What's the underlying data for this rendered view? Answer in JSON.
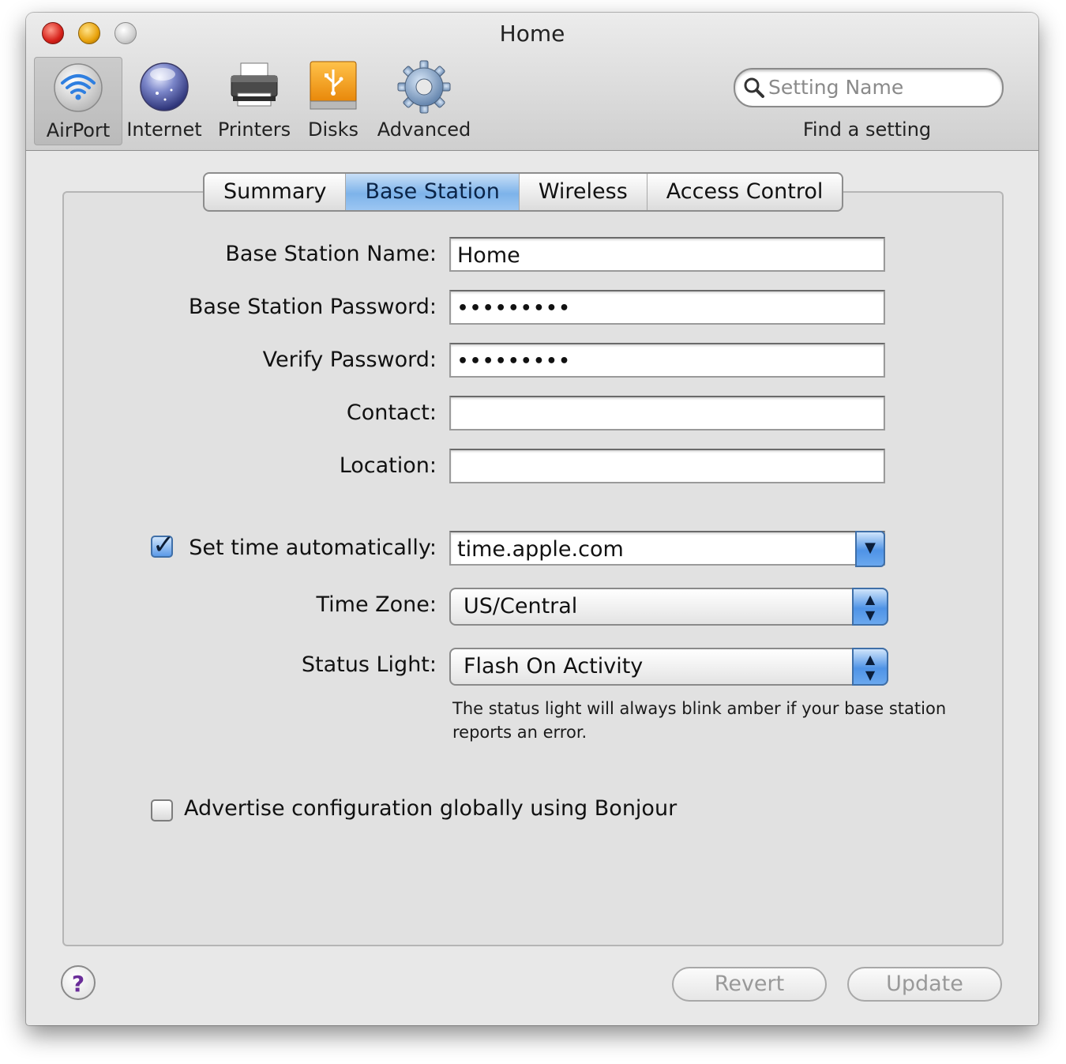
{
  "window": {
    "title": "Home"
  },
  "toolbar": {
    "items": [
      {
        "label": "AirPort",
        "icon": "airport-icon",
        "selected": true
      },
      {
        "label": "Internet",
        "icon": "internet-globe-icon"
      },
      {
        "label": "Printers",
        "icon": "printer-icon"
      },
      {
        "label": "Disks",
        "icon": "disk-usb-icon"
      },
      {
        "label": "Advanced",
        "icon": "gear-icon"
      }
    ],
    "search": {
      "placeholder": "Setting Name",
      "caption": "Find a setting"
    }
  },
  "tabs": [
    {
      "label": "Summary"
    },
    {
      "label": "Base Station",
      "active": true
    },
    {
      "label": "Wireless"
    },
    {
      "label": "Access Control"
    }
  ],
  "form": {
    "name_label": "Base Station Name:",
    "name_value": "Home",
    "password_label": "Base Station Password:",
    "password_value": "•••••••••",
    "verify_label": "Verify Password:",
    "verify_value": "•••••••••",
    "contact_label": "Contact:",
    "contact_value": "",
    "location_label": "Location:",
    "location_value": "",
    "settime_label": "Set time automatically:",
    "settime_checked": true,
    "settime_value": "time.apple.com",
    "timezone_label": "Time Zone:",
    "timezone_value": "US/Central",
    "statuslight_label": "Status Light:",
    "statuslight_value": "Flash On Activity",
    "statuslight_help": "The status light will always blink amber if your base station reports an error.",
    "bonjour_label": "Advertise configuration globally using Bonjour",
    "bonjour_checked": false
  },
  "footer": {
    "help": "?",
    "revert": "Revert",
    "update": "Update"
  },
  "colors": {
    "accent": "#5c9ae8",
    "close": "#d6211a",
    "minimize": "#e8a20c",
    "zoom": "#c8c8c8"
  }
}
